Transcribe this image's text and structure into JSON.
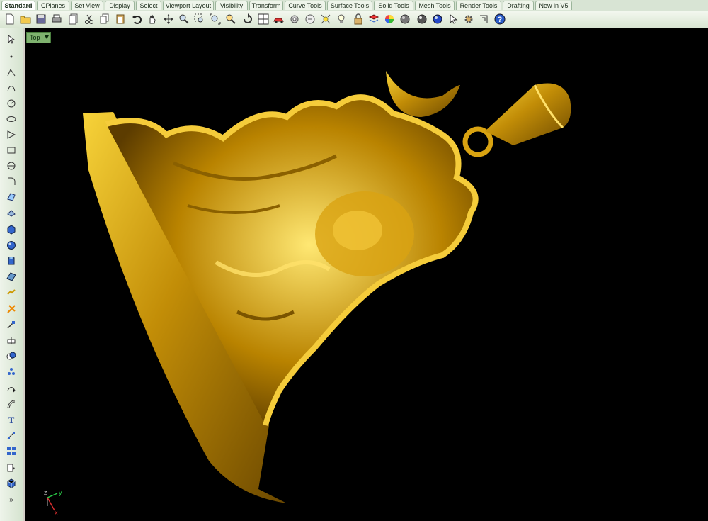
{
  "tabs": [
    {
      "label": "Standard",
      "active": true
    },
    {
      "label": "CPlanes"
    },
    {
      "label": "Set View"
    },
    {
      "label": "Display"
    },
    {
      "label": "Select"
    },
    {
      "label": "Viewport Layout"
    },
    {
      "label": "Visibility"
    },
    {
      "label": "Transform"
    },
    {
      "label": "Curve Tools"
    },
    {
      "label": "Surface Tools"
    },
    {
      "label": "Solid Tools"
    },
    {
      "label": "Mesh Tools"
    },
    {
      "label": "Render Tools"
    },
    {
      "label": "Drafting"
    },
    {
      "label": "New in V5"
    }
  ],
  "toolbar_icons": [
    "new-file-icon",
    "open-folder-icon",
    "save-icon",
    "print-icon",
    "import-icon",
    "cut-icon",
    "copy-icon",
    "paste-icon",
    "undo-icon",
    "pan-hand-icon",
    "move-view-icon",
    "zoom-icon",
    "zoom-window-icon",
    "zoom-extents-icon",
    "zoom-selected-icon",
    "rotate-view-icon",
    "four-viewports-icon",
    "car-render-icon",
    "options-icon",
    "circle-options-icon",
    "grid-snap-icon",
    "light-bulb-icon",
    "lock-icon",
    "layer-icon",
    "color-wheel-icon",
    "material-sphere-icon",
    "shaded-sphere-icon",
    "rendered-sphere-icon",
    "select-arrow-icon",
    "gear-icon",
    "dimension-icon",
    "help-icon"
  ],
  "sidebar_icons": [
    "select-arrow-icon",
    "point-icon",
    "polyline-icon",
    "curve-icon",
    "circle-icon",
    "ellipse-icon",
    "polygon-icon",
    "rectangle-icon",
    "arc-icon",
    "fillet-icon",
    "surface-icon",
    "extrude-icon",
    "box-icon",
    "sphere-icon",
    "cylinder-icon",
    "plane-icon",
    "transform-icon",
    "explode-icon",
    "trim-icon",
    "split-icon",
    "boolean-icon",
    "array-icon",
    "curve-from-object-icon",
    "offset-icon",
    "text-icon",
    "dimension-icon",
    "group-icon",
    "block-icon",
    "render-icon",
    "more-icon"
  ],
  "viewport": {
    "label": "Top",
    "axis": {
      "x": "x",
      "y": "y",
      "z": "z"
    }
  }
}
